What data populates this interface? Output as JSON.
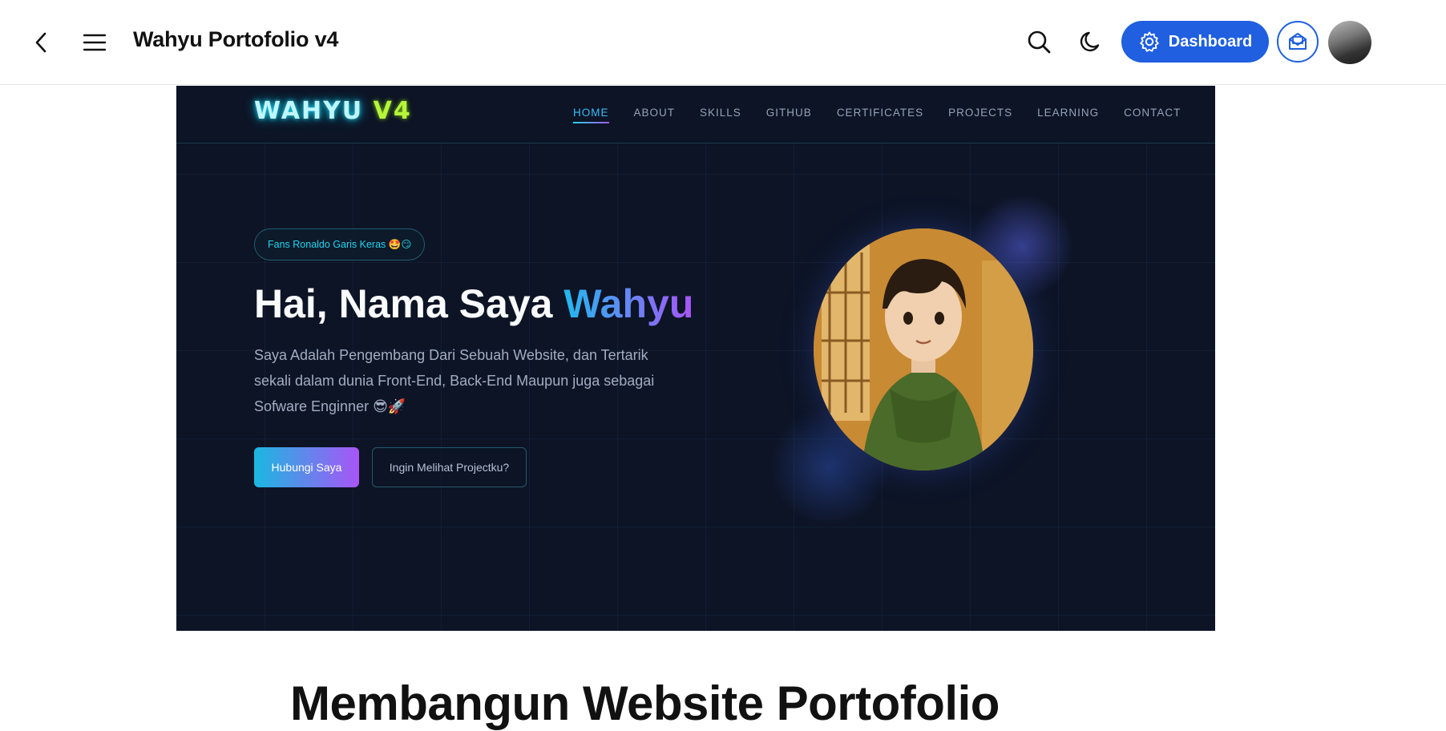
{
  "app": {
    "title": "Wahyu Portofolio v4",
    "dashboard_label": "Dashboard",
    "accent": "#1f5fe0"
  },
  "icons": [
    "back-arrow-icon",
    "hamburger-menu-icon",
    "search-icon",
    "moon-icon",
    "gear-icon",
    "mail-icon",
    "avatar"
  ],
  "hero": {
    "logo_main": "WAHYU",
    "logo_suffix": "V4",
    "nav": [
      "HOME",
      "ABOUT",
      "SKILLS",
      "GITHUB",
      "CERTIFICATES",
      "PROJECTS",
      "LEARNING",
      "CONTACT"
    ],
    "active_nav": "HOME",
    "badge": "Fans Ronaldo Garis Keras 🤩😏",
    "headline_prefix": "Hai, Nama Saya ",
    "headline_name": "Wahyu",
    "description": "Saya Adalah Pengembang Dari Sebuah Website, dan Tertarik sekali dalam dunia Front-End, Back-End Maupun juga sebagai Sofware Enginner 😎🚀",
    "primary_button": "Hubungi Saya",
    "secondary_button": "Ingin Melihat Projectku?",
    "colors": {
      "bg": "#0d1426",
      "cyan": "#22d3ee",
      "purple": "#a855f7",
      "lime": "#b6f53a"
    }
  },
  "article": {
    "title": "Membangun Website Portofolio"
  }
}
